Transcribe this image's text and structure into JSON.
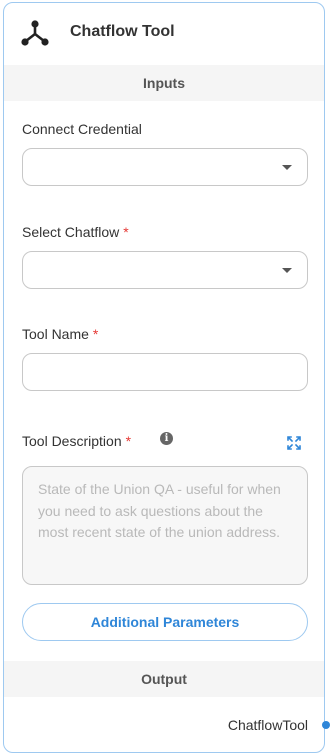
{
  "node": {
    "title": "Chatflow Tool",
    "icon": "hierarchy-icon"
  },
  "sections": {
    "inputs_label": "Inputs",
    "output_label": "Output"
  },
  "fields": {
    "credential": {
      "label": "Connect Credential",
      "value": ""
    },
    "chatflow": {
      "label": "Select Chatflow",
      "required_mark": "*",
      "value": ""
    },
    "tool_name": {
      "label": "Tool Name",
      "required_mark": "*",
      "value": ""
    },
    "tool_description": {
      "label": "Tool Description",
      "required_mark": "*",
      "info_glyph": "i",
      "placeholder": "State of the Union QA - useful for when you need to ask questions about the most recent state of the union address."
    }
  },
  "buttons": {
    "additional_parameters": "Additional Parameters"
  },
  "output": {
    "name": "ChatflowTool"
  },
  "colors": {
    "accent": "#2f86d8",
    "border": "#9ec9f0",
    "required": "#e53935"
  }
}
